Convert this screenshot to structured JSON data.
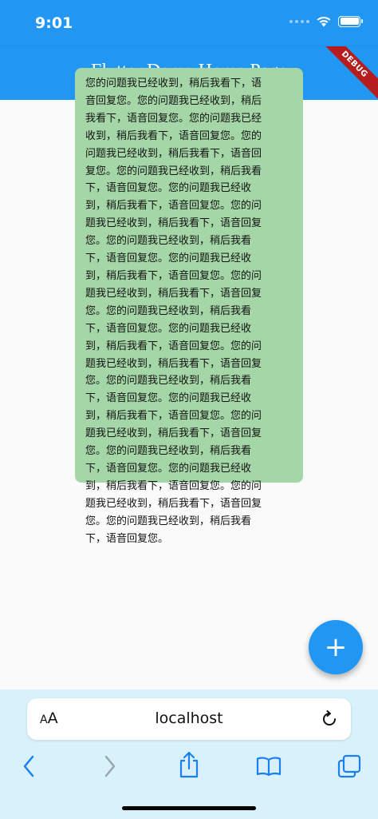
{
  "status_bar": {
    "time": "9:01",
    "battery_level": 1.0
  },
  "app_bar": {
    "title": "Flutter Demo Home Page",
    "debug_banner": "DEBUG"
  },
  "message": {
    "lines": [
      "您的问题我已经收到，稍后我看下，语",
      "音回复您。您的问题我已经收到，稍后",
      "我看下，语音回复您。您的问题我已经",
      "收到，稍后我看下，语音回复您。您的",
      "问题我已经收到，稍后我看下，语音回",
      "复您。您的问题我已经收到，稍后我看",
      "下，语音回复您。您的问题我已经收",
      "到，稍后我看下，语音回复您。您的问",
      "题我已经收到，稍后我看下，语音回复",
      "您。您的问题我已经收到，稍后我看",
      "下，语音回复您。您的问题我已经收",
      "到，稍后我看下，语音回复您。您的问",
      "题我已经收到，稍后我看下，语音回复",
      "您。您的问题我已经收到，稍后我看",
      "下，语音回复您。您的问题我已经收",
      "到，稍后我看下，语音回复您。您的问",
      "题我已经收到，稍后我看下，语音回复",
      "您。您的问题我已经收到，稍后我看",
      "下，语音回复您。您的问题我已经收",
      "到，稍后我看下，语音回复您。您的问",
      "题我已经收到，稍后我看下，语音回复",
      "您。您的问题我已经收到，稍后我看",
      "下，语音回复您。您的问题我已经收",
      "到，稍后我看下，语音回复您。您的问",
      "题我已经收到，稍后我看下，语音回复",
      "您。您的问题我已经收到，稍后我看",
      "下，语音回复您。"
    ]
  },
  "fab": {
    "icon": "add-icon",
    "label": "+"
  },
  "browser": {
    "text_size_button": "AA",
    "url": "localhost",
    "icons": [
      "reload-icon",
      "back-icon",
      "forward-icon",
      "share-icon",
      "bookmarks-icon",
      "tabs-icon"
    ]
  },
  "colors": {
    "primary": "#2196f3",
    "bubble": "#a5d6a7",
    "debug": "#b71c1c",
    "browser_bar": "#d9f1fa",
    "safari_accent": "#1a7ff1"
  }
}
